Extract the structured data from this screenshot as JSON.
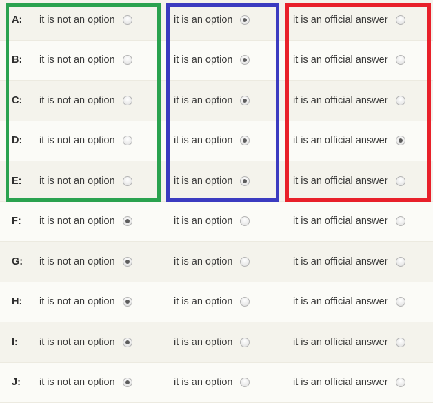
{
  "matrix": {
    "columns": [
      {
        "id": "col-not-an-option",
        "label": "it is not an option"
      },
      {
        "id": "col-an-option",
        "label": "it is an option"
      },
      {
        "id": "col-official-answer",
        "label": "it is an official answer"
      }
    ],
    "rows": [
      {
        "label": "A:",
        "selected": 1
      },
      {
        "label": "B:",
        "selected": 1
      },
      {
        "label": "C:",
        "selected": 1
      },
      {
        "label": "D:",
        "selected": 1
      },
      {
        "label": "E:",
        "selected": 1
      },
      {
        "label": "F:",
        "selected": 0
      },
      {
        "label": "G:",
        "selected": 0
      },
      {
        "label": "H:",
        "selected": 0
      },
      {
        "label": "I:",
        "selected": 0
      },
      {
        "label": "J:",
        "selected": 0
      }
    ],
    "extra_selected": [
      {
        "row": 3,
        "column": 2
      }
    ],
    "highlights": [
      {
        "id": "highlight-green",
        "color": "#2aa24f",
        "column": 0,
        "rows": "A-E"
      },
      {
        "id": "highlight-blue",
        "color": "#3b3bc0",
        "column": 1,
        "rows": "A-E"
      },
      {
        "id": "highlight-red",
        "color": "#e8202a",
        "column": 2,
        "rows": "A-E"
      }
    ],
    "row_stripe_colors": {
      "odd": "#f4f3ec",
      "even": "#fbfbf7"
    }
  }
}
